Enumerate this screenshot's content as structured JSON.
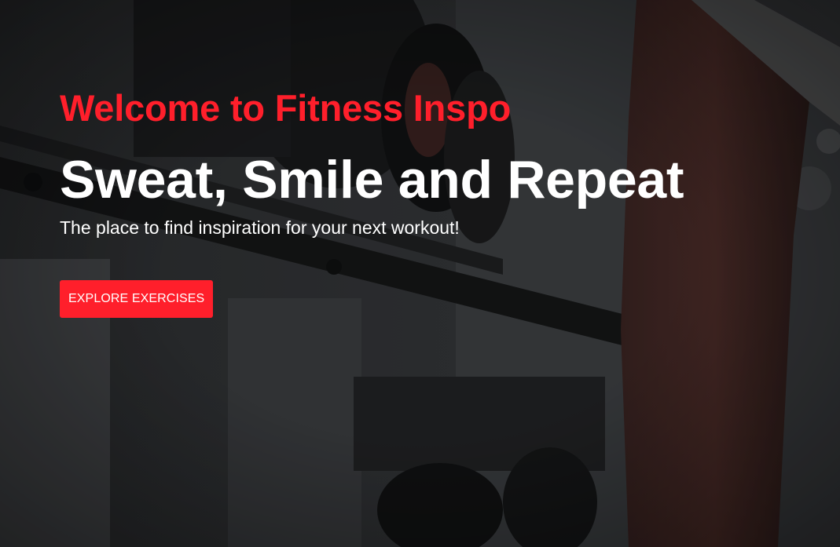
{
  "hero": {
    "welcome": "Welcome to Fitness Inspo",
    "headline": "Sweat, Smile and Repeat",
    "tagline": "The place to find inspiration for your next workout!",
    "cta_label": "EXPLORE EXERCISES"
  },
  "colors": {
    "accent": "#ff1f2b",
    "text": "#ffffff",
    "overlay": "#1a1b1d"
  },
  "icons": {
    "background": "gym-dumbbell-rack-photo"
  }
}
